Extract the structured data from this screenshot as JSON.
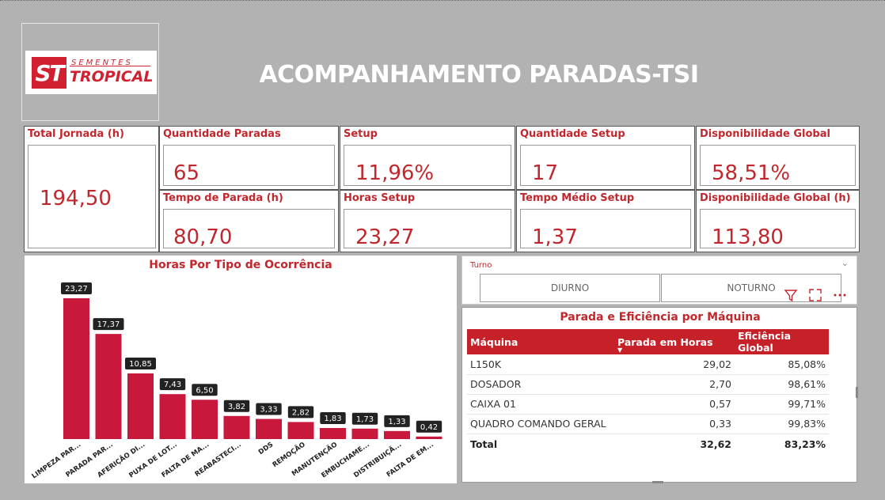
{
  "header": {
    "title": "ACOMPANHAMENTO PARADAS-TSI",
    "logo": {
      "mark": "ST",
      "top_text": "SEMENTES",
      "main_text": "TROPICAL"
    }
  },
  "kpis": {
    "total_jornada": {
      "label": "Total Jornada (h)",
      "value": "194,50"
    },
    "quantidade_paradas": {
      "label": "Quantidade Paradas",
      "value": "65"
    },
    "tempo_parada": {
      "label": "Tempo de Parada (h)",
      "value": "80,70"
    },
    "setup": {
      "label": "Setup",
      "value": "11,96%"
    },
    "horas_setup": {
      "label": "Horas Setup",
      "value": "23,27"
    },
    "quantidade_setup": {
      "label": "Quantidade Setup",
      "value": "17"
    },
    "tempo_medio_setup": {
      "label": "Tempo Médio Setup",
      "value": "1,37"
    },
    "disponibilidade_global": {
      "label": "Disponibilidade Global",
      "value": "58,51%"
    },
    "disponibilidade_global_h": {
      "label": "Disponibilidade Global (h)",
      "value": "113,80"
    }
  },
  "chart_data": {
    "type": "bar",
    "title": "Horas Por Tipo de Ocorrência",
    "categories": [
      "LIMPEZA PAR...",
      "PARADA PAR...",
      "AFERIÇÃO DI...",
      "PUXA DE LOT...",
      "FALTA DE MA...",
      "REABASTECI...",
      "DDS",
      "REMOÇÃO",
      "MANUTENÇÃO",
      "EMBUCHAME...",
      "DISTRIBUIÇÃ...",
      "FALTA DE EM..."
    ],
    "values": [
      23.27,
      17.37,
      10.85,
      7.43,
      6.5,
      3.82,
      3.33,
      2.82,
      1.83,
      1.73,
      1.33,
      0.42
    ],
    "labels": [
      "23,27",
      "17,37",
      "10,85",
      "7,43",
      "6,50",
      "3,82",
      "3,33",
      "2,82",
      "1,83",
      "1,73",
      "1,33",
      "0,42"
    ],
    "bar_color": "#c8193c",
    "ylim": [
      0,
      23.27
    ]
  },
  "slicer": {
    "title": "Turno",
    "options": [
      "DIURNO",
      "NOTURNO"
    ]
  },
  "table": {
    "title": "Parada e Eficiência por Máquina",
    "headers": [
      "Máquina",
      "Parada em Horas",
      "Eficiência Global"
    ],
    "rows": [
      [
        "L150K",
        "29,02",
        "85,08%"
      ],
      [
        "DOSADOR",
        "2,70",
        "98,61%"
      ],
      [
        "CAIXA 01",
        "0,57",
        "99,71%"
      ],
      [
        "QUADRO COMANDO GERAL",
        "0,33",
        "99,83%"
      ]
    ],
    "total": [
      "Total",
      "32,62",
      "83,23%"
    ]
  },
  "colors": {
    "accent": "#c1272d",
    "header_bg": "#c62028",
    "background": "#b2b2b2"
  }
}
